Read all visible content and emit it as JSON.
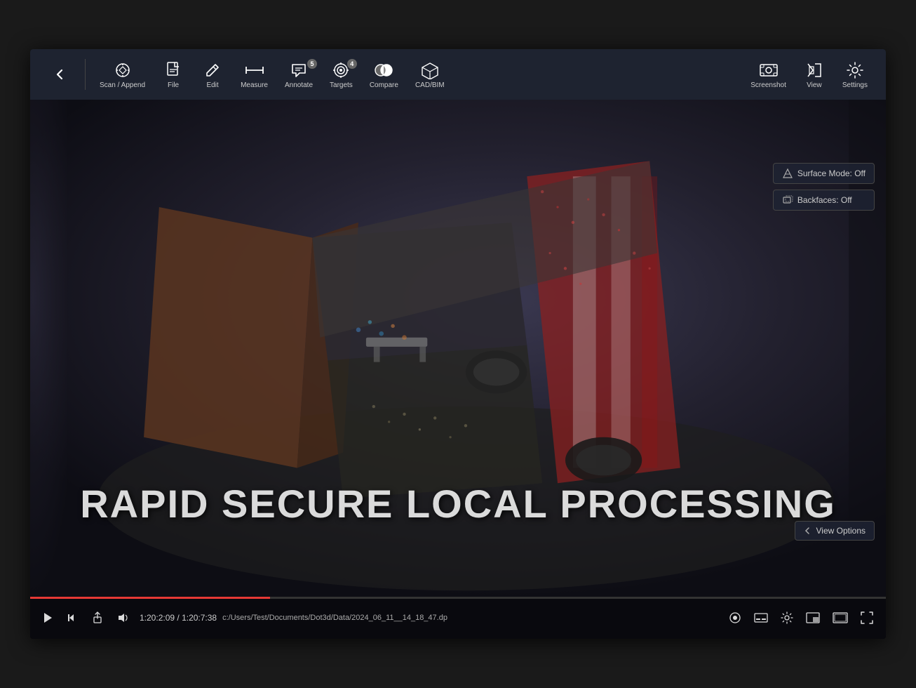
{
  "toolbar": {
    "back_label": "",
    "scan_append_label": "Scan /\nAppend",
    "file_label": "File",
    "edit_label": "Edit",
    "measure_label": "Measure",
    "annotate_label": "Annotate",
    "annotate_badge": "5",
    "targets_label": "Targets",
    "targets_badge": "4",
    "compare_label": "Compare",
    "cadbim_label": "CAD/BIM",
    "screenshot_label": "Screenshot",
    "view_label": "View",
    "settings_label": "Settings"
  },
  "viewport": {
    "big_text": "RAPID SECURE LOCAL PROCESSING",
    "surface_mode_label": "Surface Mode: Off",
    "backfaces_label": "Backfaces: Off",
    "view_options_label": "View Options"
  },
  "bottom_bar": {
    "time_current": "1:20:2:09",
    "time_total": "1:20:7:38",
    "filepath": "c:/Users/Test/Documents/Dot3d/Data/2024_06_11__14_18_47.dp"
  },
  "colors": {
    "toolbar_bg": "#1e2330",
    "progress_color": "#e53935",
    "viewport_bg": "#1e1e28"
  }
}
